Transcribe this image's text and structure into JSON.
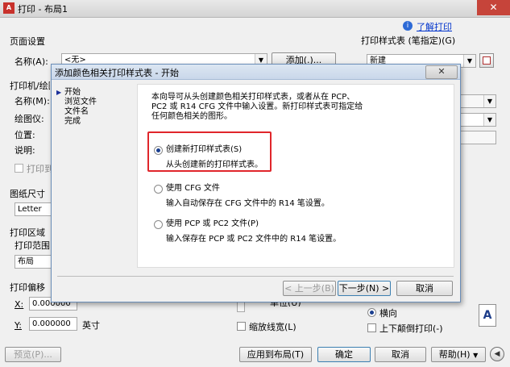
{
  "window": {
    "title": "打印 - 布局1",
    "help_link": "了解打印",
    "close_symbol": "✕",
    "app_icon": "A"
  },
  "page_setup": {
    "group_label": "页面设置",
    "name_label": "名称(A):",
    "name_value": "<无>",
    "add_button": "添加(.)..."
  },
  "printer": {
    "group_label": "打印机/绘图仪",
    "name_label": "名称(M):",
    "plotter_label": "绘图仪:",
    "location_label": "位置:",
    "desc_label": "说明:",
    "print_to_file": "打印到文件"
  },
  "paper_size": {
    "label": "图纸尺寸",
    "value": "Letter"
  },
  "plot_area": {
    "label": "打印区域",
    "range_label": "打印范围",
    "range_value": "布局"
  },
  "plot_offset": {
    "label": "打印偏移",
    "x_label": "X:",
    "x_value": "0.000000",
    "y_label": "Y:",
    "y_value": "0.000000",
    "unit": "英寸"
  },
  "scale": {
    "lineweights": "缩放线宽(L)",
    "unit_partial": "单位(U)"
  },
  "plot_style": {
    "label": "打印样式表 (笔指定)(G)",
    "value": "新建"
  },
  "orientation": {
    "landscape": "横向",
    "upside_down": "上下颠倒打印(-)",
    "icon_glyph": "A"
  },
  "bottom_buttons": {
    "preview": "预览(P)...",
    "apply": "应用到布局(T)",
    "ok": "确定",
    "cancel": "取消",
    "help": "帮助(H)",
    "expand": "◀"
  },
  "wizard": {
    "title": "添加颜色相关打印样式表 - 开始",
    "close_symbol": "✕",
    "steps": [
      "开始",
      "浏览文件",
      "文件名",
      "完成"
    ],
    "intro": [
      "本向导可从头创建颜色相关打印样式表，或者从在 PCP、",
      "PC2 或 R14 CFG 文件中输入设置。新打印样式表可指定给",
      "任何颜色相关的图形。"
    ],
    "options": [
      {
        "label": "创建新打印样式表(S)",
        "desc": "从头创建新的打印样式表。",
        "selected": true
      },
      {
        "label": "使用 CFG 文件",
        "desc": "输入自动保存在 CFG 文件中的 R14 笔设置。",
        "selected": false
      },
      {
        "label": "使用 PCP 或 PC2 文件(P)",
        "desc": "输入保存在 PCP 或 PC2 文件中的 R14 笔设置。",
        "selected": false
      }
    ],
    "back_button": "< 上一步(B)",
    "next_button": "下一步(N) >",
    "cancel_button": "取消"
  },
  "colors": {
    "highlight_border": "#e0262b",
    "close_red": "#c6443a",
    "link_blue": "#0033cc"
  }
}
